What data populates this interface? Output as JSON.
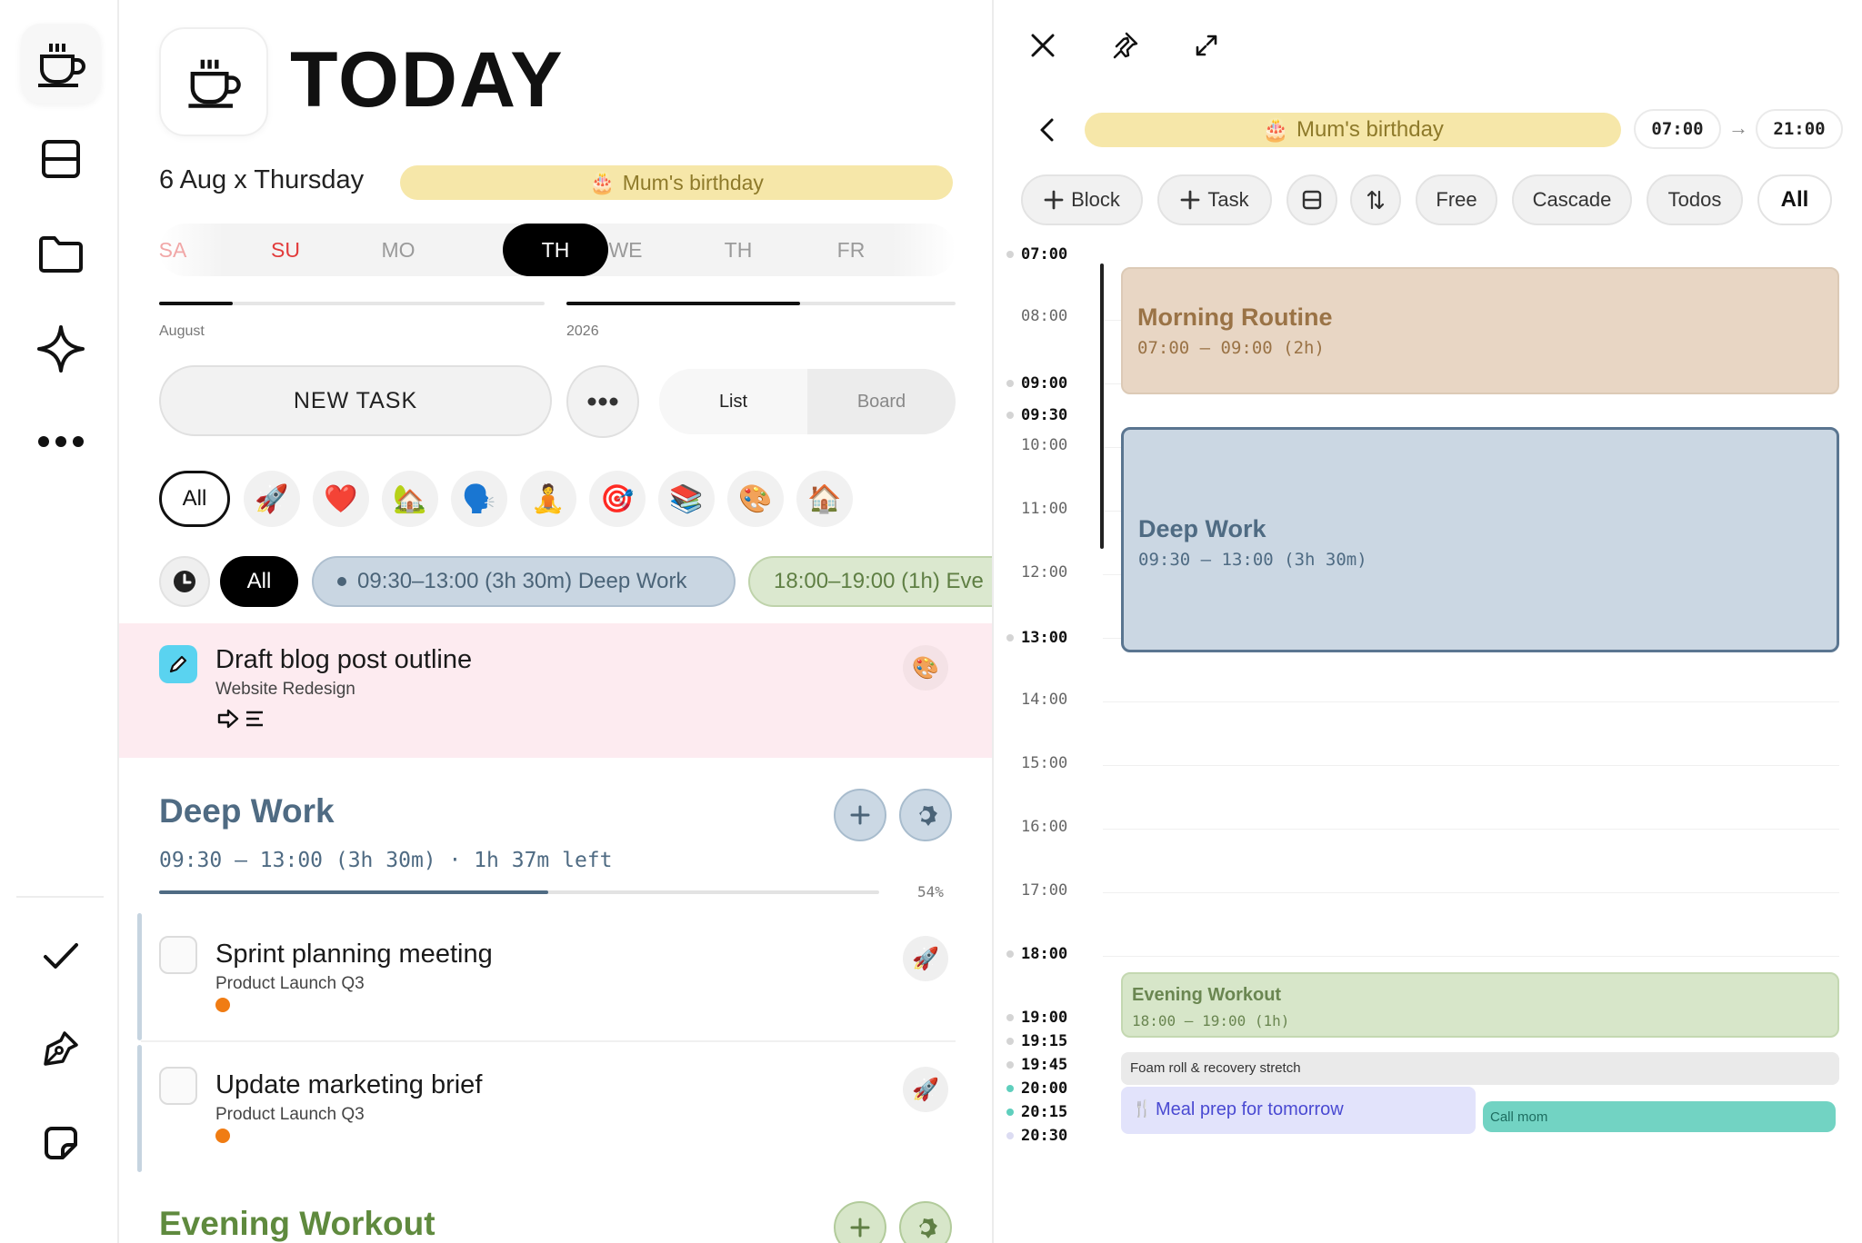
{
  "rail": {
    "items": [
      "today",
      "layout",
      "folder",
      "sparkle",
      "more",
      "check",
      "pen",
      "sticky-note"
    ]
  },
  "header": {
    "title": "TODAY",
    "date": "6 Aug x Thursday",
    "birthday": "Mum's birthday",
    "birthday_icon": "🎂"
  },
  "days": {
    "items": [
      {
        "label": "SA",
        "kind": "sat"
      },
      {
        "label": "SU",
        "kind": "sun"
      },
      {
        "label": "MO",
        "kind": "normal"
      },
      {
        "label": "TH",
        "kind": "selected"
      },
      {
        "label": "WE",
        "kind": "normal"
      },
      {
        "label": "TH",
        "kind": "normal"
      },
      {
        "label": "FR",
        "kind": "normal"
      }
    ],
    "month_label": "August",
    "month_progress": 0.19,
    "year_label": "2026",
    "year_progress": 0.6
  },
  "toolbar": {
    "new_task": "NEW TASK",
    "view_list": "List",
    "view_board": "Board"
  },
  "categories": {
    "all": "All",
    "icons": [
      "🚀",
      "❤️",
      "🏡",
      "🗣️",
      "🧘",
      "🎯",
      "📚",
      "🎨",
      "🏠"
    ]
  },
  "blocks_filter": {
    "all": "All",
    "deep_work_chip": "09:30–13:00 (3h 30m)  Deep Work",
    "evening_chip": "18:00–19:00 (1h)  Eve"
  },
  "pinned_task": {
    "title": "Draft blog post outline",
    "project": "Website Redesign",
    "category_icon": "🎨"
  },
  "deep_work": {
    "title": "Deep Work",
    "subtitle": "09:30 — 13:00 (3h 30m) · 1h 37m left",
    "progress_label": "54%",
    "progress": 0.54,
    "tasks": [
      {
        "title": "Sprint planning meeting",
        "project": "Product Launch Q3",
        "icon": "🚀"
      },
      {
        "title": "Update marketing brief",
        "project": "Product Launch Q3",
        "icon": "🚀"
      }
    ]
  },
  "evening": {
    "title": "Evening Workout"
  },
  "calendar": {
    "birthday": "Mum's birthday",
    "birthday_icon": "🎂",
    "start_time": "07:00",
    "end_time": "21:00",
    "arrow": "→",
    "buttons": {
      "block": "Block",
      "task": "Task",
      "free": "Free",
      "cascade": "Cascade",
      "todos": "Todos",
      "all": "All"
    },
    "hours": [
      {
        "label": "07:00",
        "bold": true,
        "dot": "#d4d4d4"
      },
      {
        "label": "08:00",
        "bold": false,
        "dot": ""
      },
      {
        "label": "09:00",
        "bold": true,
        "dot": "#d4d4d4"
      },
      {
        "label": "09:30",
        "bold": true,
        "dot": "#d4d4d4"
      },
      {
        "label": "10:00",
        "bold": false,
        "dot": ""
      },
      {
        "label": "11:00",
        "bold": false,
        "dot": ""
      },
      {
        "label": "12:00",
        "bold": false,
        "dot": ""
      },
      {
        "label": "13:00",
        "bold": true,
        "dot": "#d4d4d4"
      },
      {
        "label": "14:00",
        "bold": false,
        "dot": ""
      },
      {
        "label": "15:00",
        "bold": false,
        "dot": ""
      },
      {
        "label": "16:00",
        "bold": false,
        "dot": ""
      },
      {
        "label": "17:00",
        "bold": false,
        "dot": ""
      },
      {
        "label": "18:00",
        "bold": true,
        "dot": "#d4d4d4"
      },
      {
        "label": "19:00",
        "bold": true,
        "dot": "#d4d4d4"
      },
      {
        "label": "19:15",
        "bold": true,
        "dot": "#d4d4d4"
      },
      {
        "label": "19:45",
        "bold": true,
        "dot": "#d4d4d4"
      },
      {
        "label": "20:00",
        "bold": true,
        "dot": "#5fcfbd"
      },
      {
        "label": "20:15",
        "bold": true,
        "dot": "#5fcfbd"
      },
      {
        "label": "20:30",
        "bold": true,
        "dot": "#dcdcf2"
      }
    ],
    "events": {
      "morning": {
        "title": "Morning Routine",
        "time": "07:00 – 09:00 (2h)"
      },
      "deep": {
        "title": "Deep Work",
        "time": "09:30 – 13:00 (3h 30m)"
      },
      "evening": {
        "title": "Evening Workout",
        "time": "18:00 – 19:00 (1h)"
      },
      "foam": {
        "title": "Foam roll & recovery stretch"
      },
      "meal": {
        "title": "Meal prep for tomorrow",
        "icon": "🍴"
      },
      "call": {
        "title": "Call mom"
      }
    }
  },
  "colors": {
    "birthday_bg": "#f6e7a9",
    "deep_work": "#4f6b83",
    "evening": "#5f8a3e",
    "pink_row": "#fdebf0",
    "accent_orange": "#f07c13",
    "teal": "#72d3c3"
  }
}
